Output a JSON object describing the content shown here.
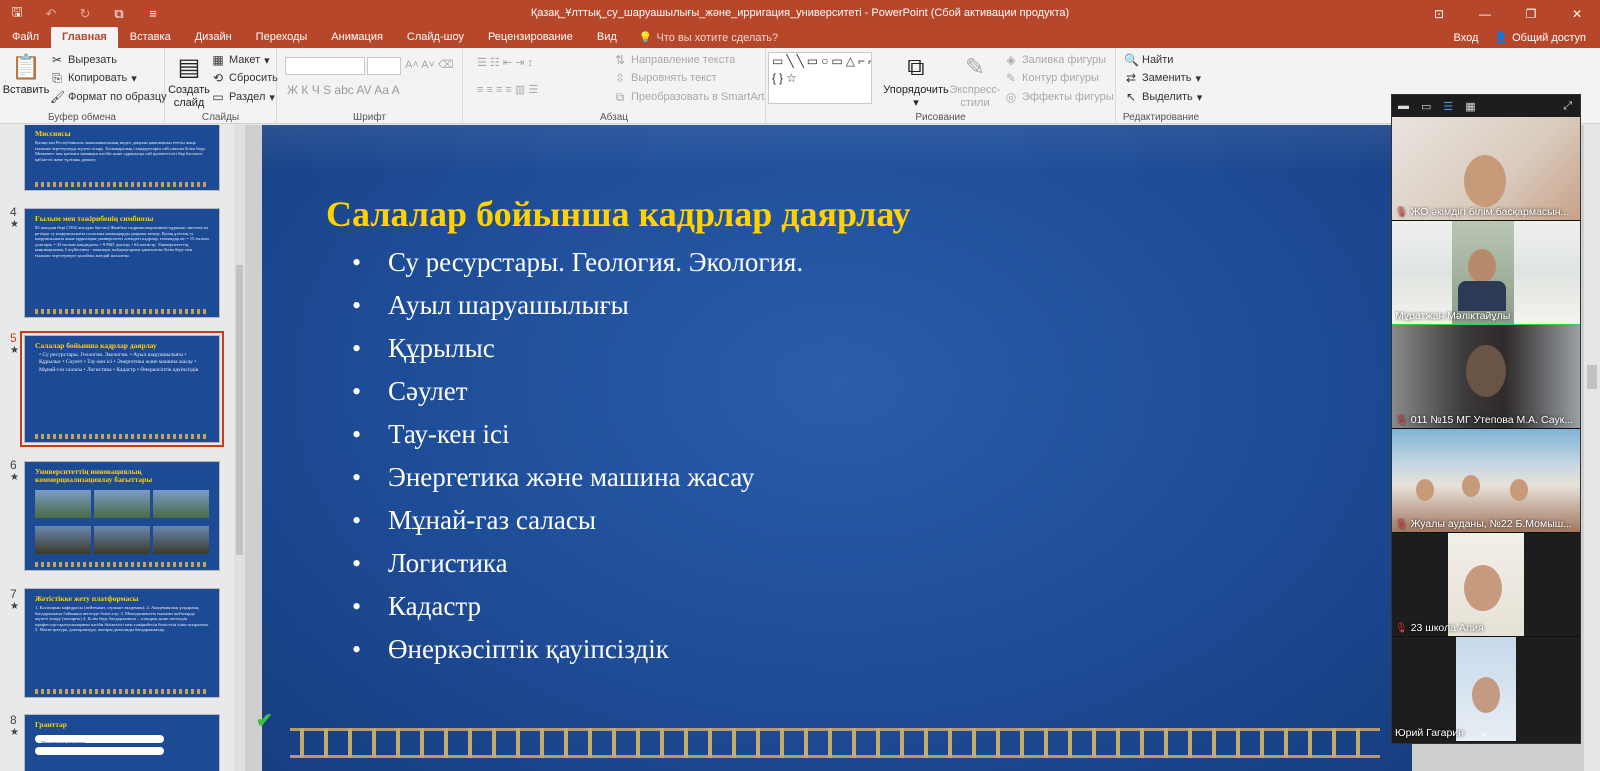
{
  "window": {
    "title": "Қазақ_Ұлттық_су_шаруашылығы_және_ирригация_университеті - PowerPoint (Сбой активации продукта)"
  },
  "quick_access": {
    "save": "🖫",
    "undo": "↶",
    "redo": "↻",
    "present": "⧉",
    "customize": "≡"
  },
  "window_controls": {
    "ribbon_options": "⊡",
    "minimize": "—",
    "restore": "❐",
    "close": "✕"
  },
  "tabs": [
    {
      "label": "Файл",
      "active": false
    },
    {
      "label": "Главная",
      "active": true
    },
    {
      "label": "Вставка",
      "active": false
    },
    {
      "label": "Дизайн",
      "active": false
    },
    {
      "label": "Переходы",
      "active": false
    },
    {
      "label": "Анимация",
      "active": false
    },
    {
      "label": "Слайд-шоу",
      "active": false
    },
    {
      "label": "Рецензирование",
      "active": false
    },
    {
      "label": "Вид",
      "active": false
    }
  ],
  "tell_me": "Что вы хотите сделать?",
  "account": {
    "signin": "Вход",
    "share": "Общий доступ"
  },
  "ribbon": {
    "clipboard": {
      "label": "Буфер обмена",
      "paste": "Вставить",
      "cut": "Вырезать",
      "copy": "Копировать",
      "format_painter": "Формат по образцу"
    },
    "slides": {
      "label": "Слайды",
      "new_slide_l1": "Создать",
      "new_slide_l2": "слайд",
      "layout": "Макет",
      "reset": "Сбросить",
      "section": "Раздел"
    },
    "font": {
      "label": "Шрифт",
      "format_glyphs": "Ж К Ч S abc AV Aa A"
    },
    "paragraph": {
      "label": "Абзац",
      "text_direction": "Направление текста",
      "align_text": "Выровнять текст",
      "smartart": "Преобразовать в SmartArt"
    },
    "drawing": {
      "label": "Рисование",
      "arrange": "Упорядочить",
      "quick_styles_l1": "Экспресс-",
      "quick_styles_l2": "стили",
      "shape_fill": "Заливка фигуры",
      "shape_outline": "Контур фигуры",
      "shape_effects": "Эффекты фигуры",
      "shapes_glyphs": "▭╲╲▭○▭△⌐⌐⇨⇩◯⌇⌒ {}☆"
    },
    "editing": {
      "label": "Редактирование",
      "find": "Найти",
      "replace": "Заменить",
      "select": "Выделить"
    }
  },
  "thumbnails": [
    {
      "number": "",
      "title": "Миссиясы",
      "body": "Қазақстан Республикасы экономикасының жедел дамуын қамтамасыз ететін жаңа ғылыми зерттеулерді жүзеге асыру. Халықаралық стандарттарға сай сапалы білім беру. Мемлекет пен қоғамға заманауи кәсіби және сұранысқа сай қызметтілігі бар бәсекеге қабілетті жеке тұлғаны дамыту."
    },
    {
      "number": "4",
      "title": "Ғылым мен тәжірибенің симбиозы",
      "body": "85 жылдан бері (1952 жылдан бастап) Жамбыл гидромелиоративтік-құрылыс институты ретінде су шаруашылығы саласына мамандарды даярлап келеді. Қазақ ұлттық су шаруашылығы және ирригация университеті әлемдегі кадрлар, ғалымдар ие: • 15 ғылым докторы; • 43 ғылым кандидаты; • 9 PhD доктор; • 64 магистр. Университеттің инновациялық 5 жүйесімен - заманауи жабдықтармен қамтылған білім беру мен ғылыми зерттеулерге қолайлы жағдай жасалған."
    },
    {
      "number": "5",
      "title": "Салалар бойынша кадрлар даярлау",
      "body": "• Су ресурстары. Геология. Экология. • Ауыл шаруашылығы • Құрылыс • Сәулет • Тау-кен ісі • Энергетика және машина жасау • Мұнай-газ саласы • Логистика • Кадастр • Өнеркәсіптік қауіпсіздік"
    },
    {
      "number": "6",
      "title": "Университеттің инновациялық коммерциализациялау бағыттары",
      "body": ""
    },
    {
      "number": "7",
      "title": "Жетістікке жету платформасы",
      "body": "1. Кәсіпорын кафедрасы (лейтенант, сержант академия); 2. Академиялық ұтқырлық бағдарламасы бойынша шетелде білім алу; 3. Менеджменттік ғылыми жобаларда жүзеге асыру (жоғарғы) 4. Білім беру бағдарламасы – отандық және шетелдік профессор-оқытушылармен кәсіби біліктілігі мен тәжірибесін бөлісетін ісіне асыралған. 5. Магистратура, докторантура, жоғары дипломды бағдарламалар."
    },
    {
      "number": "8",
      "title": "Гранттар",
      "body": "Мемлекеттік тапсырыс"
    }
  ],
  "slide": {
    "title": "Салалар бойынша кадрлар даярлау",
    "bullets": [
      "Су ресурстары. Геология. Экология.",
      "Ауыл шаруашылығы",
      "Құрылыс",
      "Сәулет",
      "Тау-кен ісі",
      "Энергетика және машина жасау",
      "Мұнай-газ саласы",
      "Логистика",
      "Кадастр",
      "Өнеркәсіптік қауіпсіздік"
    ],
    "colors": {
      "title": "#ffd200",
      "background": "#1f4e99",
      "ornament": "#c9a55c"
    }
  },
  "video_call": {
    "participants": [
      {
        "name": "ЖО әкімдігі білім басқармасын...",
        "muted": true
      },
      {
        "name": "Мұратжан Мәліктайұлы",
        "muted": false,
        "speaking": true
      },
      {
        "name": "011 №15 МГ Утепова М.А. Саук...",
        "muted": true
      },
      {
        "name": "Жуалы ауданы, №22 Б.Момыш...",
        "muted": true
      },
      {
        "name": "23 школа Алия",
        "muted": true
      },
      {
        "name": "Юрий Гагарин",
        "muted": false
      }
    ]
  }
}
